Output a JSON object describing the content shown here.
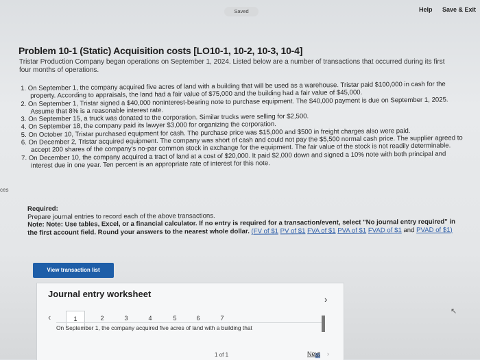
{
  "topbar": {
    "saved": "Saved",
    "help": "Help",
    "save_exit": "Save & Exit"
  },
  "title": "Problem 10-1 (Static) Acquisition costs [LO10-1, 10-2, 10-3, 10-4]",
  "intro": "Tristar Production Company began operations on September 1, 2024. Listed below are a number of transactions that occurred during its first four months of operations.",
  "transactions": [
    "1. On September 1, the company acquired five acres of land with a building that will be used as a warehouse. Tristar paid $100,000 in cash for the property. According to appraisals, the land had a fair value of $75,000 and the building had a fair value of $45,000.",
    "2. On September 1, Tristar signed a $40,000 noninterest-bearing note to purchase equipment. The $40,000 payment is due on September 1, 2025. Assume that 8% is a reasonable interest rate.",
    "3. On September 15, a truck was donated to the corporation. Similar trucks were selling for $2,500.",
    "4. On September 18, the company paid its lawyer $3,000 for organizing the corporation.",
    "5. On October 10, Tristar purchased equipment for cash. The purchase price was $15,000 and $500 in freight charges also were paid.",
    "6. On December 2, Tristar acquired equipment. The company was short of cash and could not pay the $5,500 normal cash price. The supplier agreed to accept 200 shares of the company's no-par common stock in exchange for the equipment. The fair value of the stock is not readily determinable.",
    "7. On December 10, the company acquired a tract of land at a cost of $20,000. It paid $2,000 down and signed a 10% note with both principal and interest due in one year. Ten percent is an appropriate rate of interest for this note."
  ],
  "side_tab": "ces",
  "required": {
    "heading": "Required:",
    "text": "Prepare journal entries to record each of the above transactions.",
    "note": "Note: Note: Use tables, Excel, or a financial calculator. If no entry is required for a transaction/event, select \"No journal entry required\" in the first account field. Round your answers to the nearest whole dollar.",
    "links": [
      "(FV of $1",
      "PV of $1",
      "FVA of $1",
      "PVA of $1",
      "FVAD of $1",
      "PVAD of $1)"
    ],
    "and": "and"
  },
  "view_button": "View transaction list",
  "worksheet": {
    "title": "Journal entry worksheet",
    "pages": [
      "1",
      "2",
      "3",
      "4",
      "5",
      "6",
      "7"
    ],
    "description": "On September 1, the company acquired five acres of land with a building that",
    "footer": "1 of 1"
  },
  "next": "Next",
  "colors": {
    "link": "#2b5ca8",
    "button": "#1e5ea8"
  }
}
